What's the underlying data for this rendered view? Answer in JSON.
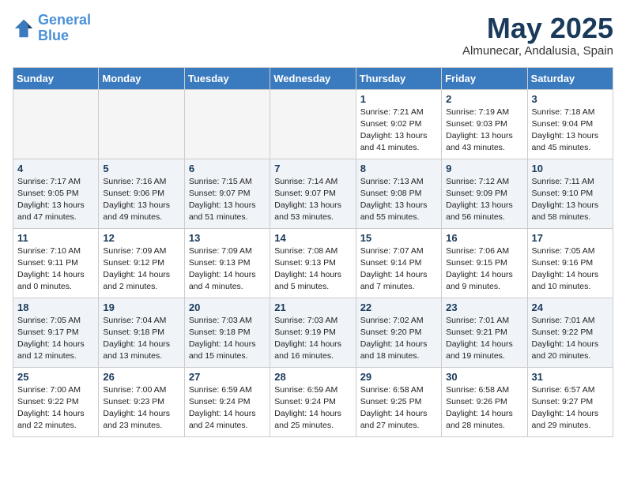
{
  "logo": {
    "line1": "General",
    "line2": "Blue"
  },
  "title": "May 2025",
  "location": "Almunecar, Andalusia, Spain",
  "days_of_week": [
    "Sunday",
    "Monday",
    "Tuesday",
    "Wednesday",
    "Thursday",
    "Friday",
    "Saturday"
  ],
  "weeks": [
    [
      {
        "num": "",
        "info": ""
      },
      {
        "num": "",
        "info": ""
      },
      {
        "num": "",
        "info": ""
      },
      {
        "num": "",
        "info": ""
      },
      {
        "num": "1",
        "info": "Sunrise: 7:21 AM\nSunset: 9:02 PM\nDaylight: 13 hours\nand 41 minutes."
      },
      {
        "num": "2",
        "info": "Sunrise: 7:19 AM\nSunset: 9:03 PM\nDaylight: 13 hours\nand 43 minutes."
      },
      {
        "num": "3",
        "info": "Sunrise: 7:18 AM\nSunset: 9:04 PM\nDaylight: 13 hours\nand 45 minutes."
      }
    ],
    [
      {
        "num": "4",
        "info": "Sunrise: 7:17 AM\nSunset: 9:05 PM\nDaylight: 13 hours\nand 47 minutes."
      },
      {
        "num": "5",
        "info": "Sunrise: 7:16 AM\nSunset: 9:06 PM\nDaylight: 13 hours\nand 49 minutes."
      },
      {
        "num": "6",
        "info": "Sunrise: 7:15 AM\nSunset: 9:07 PM\nDaylight: 13 hours\nand 51 minutes."
      },
      {
        "num": "7",
        "info": "Sunrise: 7:14 AM\nSunset: 9:07 PM\nDaylight: 13 hours\nand 53 minutes."
      },
      {
        "num": "8",
        "info": "Sunrise: 7:13 AM\nSunset: 9:08 PM\nDaylight: 13 hours\nand 55 minutes."
      },
      {
        "num": "9",
        "info": "Sunrise: 7:12 AM\nSunset: 9:09 PM\nDaylight: 13 hours\nand 56 minutes."
      },
      {
        "num": "10",
        "info": "Sunrise: 7:11 AM\nSunset: 9:10 PM\nDaylight: 13 hours\nand 58 minutes."
      }
    ],
    [
      {
        "num": "11",
        "info": "Sunrise: 7:10 AM\nSunset: 9:11 PM\nDaylight: 14 hours\nand 0 minutes."
      },
      {
        "num": "12",
        "info": "Sunrise: 7:09 AM\nSunset: 9:12 PM\nDaylight: 14 hours\nand 2 minutes."
      },
      {
        "num": "13",
        "info": "Sunrise: 7:09 AM\nSunset: 9:13 PM\nDaylight: 14 hours\nand 4 minutes."
      },
      {
        "num": "14",
        "info": "Sunrise: 7:08 AM\nSunset: 9:13 PM\nDaylight: 14 hours\nand 5 minutes."
      },
      {
        "num": "15",
        "info": "Sunrise: 7:07 AM\nSunset: 9:14 PM\nDaylight: 14 hours\nand 7 minutes."
      },
      {
        "num": "16",
        "info": "Sunrise: 7:06 AM\nSunset: 9:15 PM\nDaylight: 14 hours\nand 9 minutes."
      },
      {
        "num": "17",
        "info": "Sunrise: 7:05 AM\nSunset: 9:16 PM\nDaylight: 14 hours\nand 10 minutes."
      }
    ],
    [
      {
        "num": "18",
        "info": "Sunrise: 7:05 AM\nSunset: 9:17 PM\nDaylight: 14 hours\nand 12 minutes."
      },
      {
        "num": "19",
        "info": "Sunrise: 7:04 AM\nSunset: 9:18 PM\nDaylight: 14 hours\nand 13 minutes."
      },
      {
        "num": "20",
        "info": "Sunrise: 7:03 AM\nSunset: 9:18 PM\nDaylight: 14 hours\nand 15 minutes."
      },
      {
        "num": "21",
        "info": "Sunrise: 7:03 AM\nSunset: 9:19 PM\nDaylight: 14 hours\nand 16 minutes."
      },
      {
        "num": "22",
        "info": "Sunrise: 7:02 AM\nSunset: 9:20 PM\nDaylight: 14 hours\nand 18 minutes."
      },
      {
        "num": "23",
        "info": "Sunrise: 7:01 AM\nSunset: 9:21 PM\nDaylight: 14 hours\nand 19 minutes."
      },
      {
        "num": "24",
        "info": "Sunrise: 7:01 AM\nSunset: 9:22 PM\nDaylight: 14 hours\nand 20 minutes."
      }
    ],
    [
      {
        "num": "25",
        "info": "Sunrise: 7:00 AM\nSunset: 9:22 PM\nDaylight: 14 hours\nand 22 minutes."
      },
      {
        "num": "26",
        "info": "Sunrise: 7:00 AM\nSunset: 9:23 PM\nDaylight: 14 hours\nand 23 minutes."
      },
      {
        "num": "27",
        "info": "Sunrise: 6:59 AM\nSunset: 9:24 PM\nDaylight: 14 hours\nand 24 minutes."
      },
      {
        "num": "28",
        "info": "Sunrise: 6:59 AM\nSunset: 9:24 PM\nDaylight: 14 hours\nand 25 minutes."
      },
      {
        "num": "29",
        "info": "Sunrise: 6:58 AM\nSunset: 9:25 PM\nDaylight: 14 hours\nand 27 minutes."
      },
      {
        "num": "30",
        "info": "Sunrise: 6:58 AM\nSunset: 9:26 PM\nDaylight: 14 hours\nand 28 minutes."
      },
      {
        "num": "31",
        "info": "Sunrise: 6:57 AM\nSunset: 9:27 PM\nDaylight: 14 hours\nand 29 minutes."
      }
    ]
  ]
}
